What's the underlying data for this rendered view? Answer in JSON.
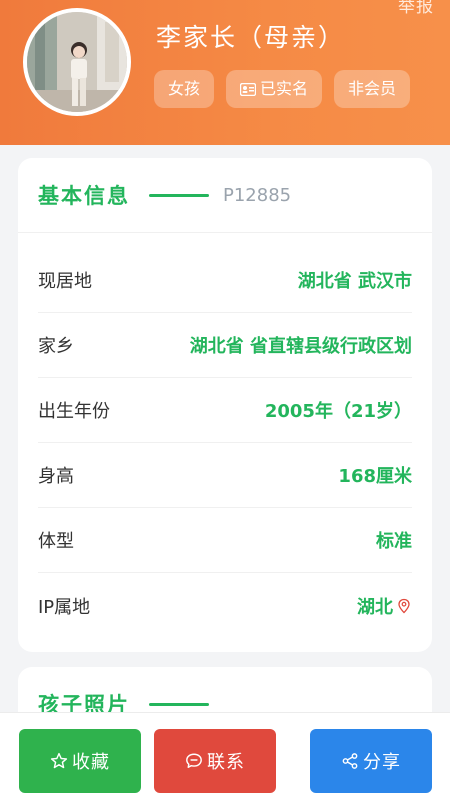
{
  "header": {
    "report_label": "举报",
    "name": "李家长（母亲）",
    "tags": [
      "女孩",
      "已实名",
      "非会员"
    ]
  },
  "basic_info": {
    "title": "基本信息",
    "user_id": "P12885",
    "rows": [
      {
        "label": "现居地",
        "value": "湖北省 武汉市"
      },
      {
        "label": "家乡",
        "value": "湖北省 省直辖县级行政区划"
      },
      {
        "label": "出生年份",
        "value": "2005年（21岁）"
      },
      {
        "label": "身高",
        "value": "168厘米"
      },
      {
        "label": "体型",
        "value": "标准"
      },
      {
        "label": "IP属地",
        "value": "湖北"
      }
    ]
  },
  "photos": {
    "title": "孩子照片"
  },
  "actions": {
    "favorite": "收藏",
    "contact": "联系",
    "share": "分享"
  },
  "colors": {
    "header_orange": "#f58a45",
    "accent_green": "#23b55c",
    "contact_red": "#e0493d",
    "share_blue": "#2b86ea"
  },
  "icons": [
    "star-icon",
    "chat-icon",
    "share-icon",
    "id-card-icon",
    "ip-location-icon"
  ]
}
